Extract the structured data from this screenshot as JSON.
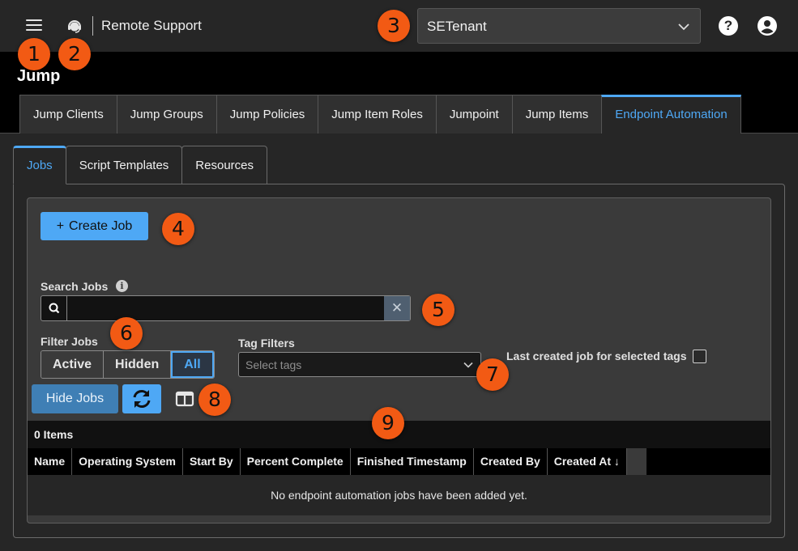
{
  "header": {
    "brand": "Remote Support",
    "tenant": "SETenant",
    "help_label": "?"
  },
  "page": {
    "title": "Jump"
  },
  "tabs": [
    {
      "label": "Jump Clients"
    },
    {
      "label": "Jump Groups"
    },
    {
      "label": "Jump Policies"
    },
    {
      "label": "Jump Item Roles"
    },
    {
      "label": "Jumpoint"
    },
    {
      "label": "Jump Items"
    },
    {
      "label": "Endpoint Automation",
      "active": true
    }
  ],
  "subtabs": [
    {
      "label": "Jobs",
      "active": true
    },
    {
      "label": "Script Templates"
    },
    {
      "label": "Resources"
    }
  ],
  "toolbar": {
    "create_plus": "+",
    "create_label": "Create Job",
    "hide_label": "Hide Jobs"
  },
  "search": {
    "label": "Search Jobs",
    "value": "",
    "placeholder": "",
    "info": "i",
    "clear": "✕"
  },
  "filter": {
    "label": "Filter Jobs",
    "options": [
      "Active",
      "Hidden",
      "All"
    ],
    "selected": "All"
  },
  "tags": {
    "label": "Tag Filters",
    "placeholder": "Select tags",
    "last_created_label": "Last created job for selected tags",
    "last_created_checked": false
  },
  "table": {
    "count_text": "0 Items",
    "columns": [
      "Name",
      "Operating System",
      "Start By",
      "Percent Complete",
      "Finished Timestamp",
      "Created By",
      "Created At ↓"
    ],
    "empty_text": "No endpoint automation jobs have been added yet."
  },
  "badges": [
    "1",
    "2",
    "3",
    "4",
    "5",
    "6",
    "7",
    "8",
    "9"
  ],
  "colors": {
    "accent": "#4ea8f5",
    "badge": "#f25a14",
    "background": "#262626"
  },
  "icons": [
    "menu-icon",
    "headset-icon",
    "chevron-down-icon",
    "help-icon",
    "user-icon",
    "info-icon",
    "search-icon",
    "close-icon",
    "refresh-icon",
    "columns-icon"
  ]
}
